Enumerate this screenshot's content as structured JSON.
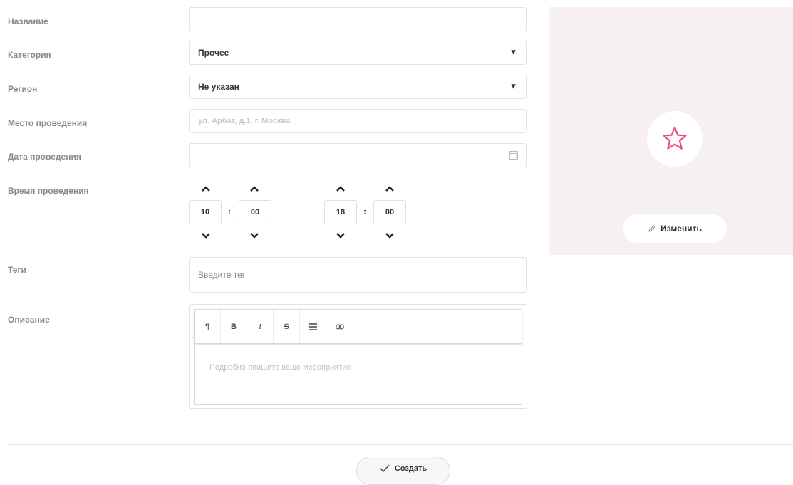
{
  "labels": {
    "name": "Название",
    "category": "Категория",
    "region": "Регион",
    "venue": "Место проведения",
    "date": "Дата проведения",
    "time": "Время проведения",
    "tags": "Теги",
    "description": "Описание"
  },
  "fields": {
    "name": {
      "value": ""
    },
    "category": {
      "value": "Прочее"
    },
    "region": {
      "value": "Не указан"
    },
    "venue": {
      "placeholder": "ул. Арбат, д.1, г. Москва"
    },
    "date": {
      "value": ""
    },
    "tags": {
      "placeholder": "Введите тег"
    }
  },
  "time": {
    "start_hour": "10",
    "start_minute": "00",
    "end_hour": "18",
    "end_minute": "00",
    "separator": ":"
  },
  "editor": {
    "toolbar": [
      "¶",
      "B",
      "I",
      "S",
      "list",
      "link"
    ],
    "placeholder": "Подробно опишите ваше мероприятие"
  },
  "image_panel": {
    "change_label": "Изменить",
    "accent_color": "#e94b8c"
  },
  "footer": {
    "create_label": "Создать"
  }
}
